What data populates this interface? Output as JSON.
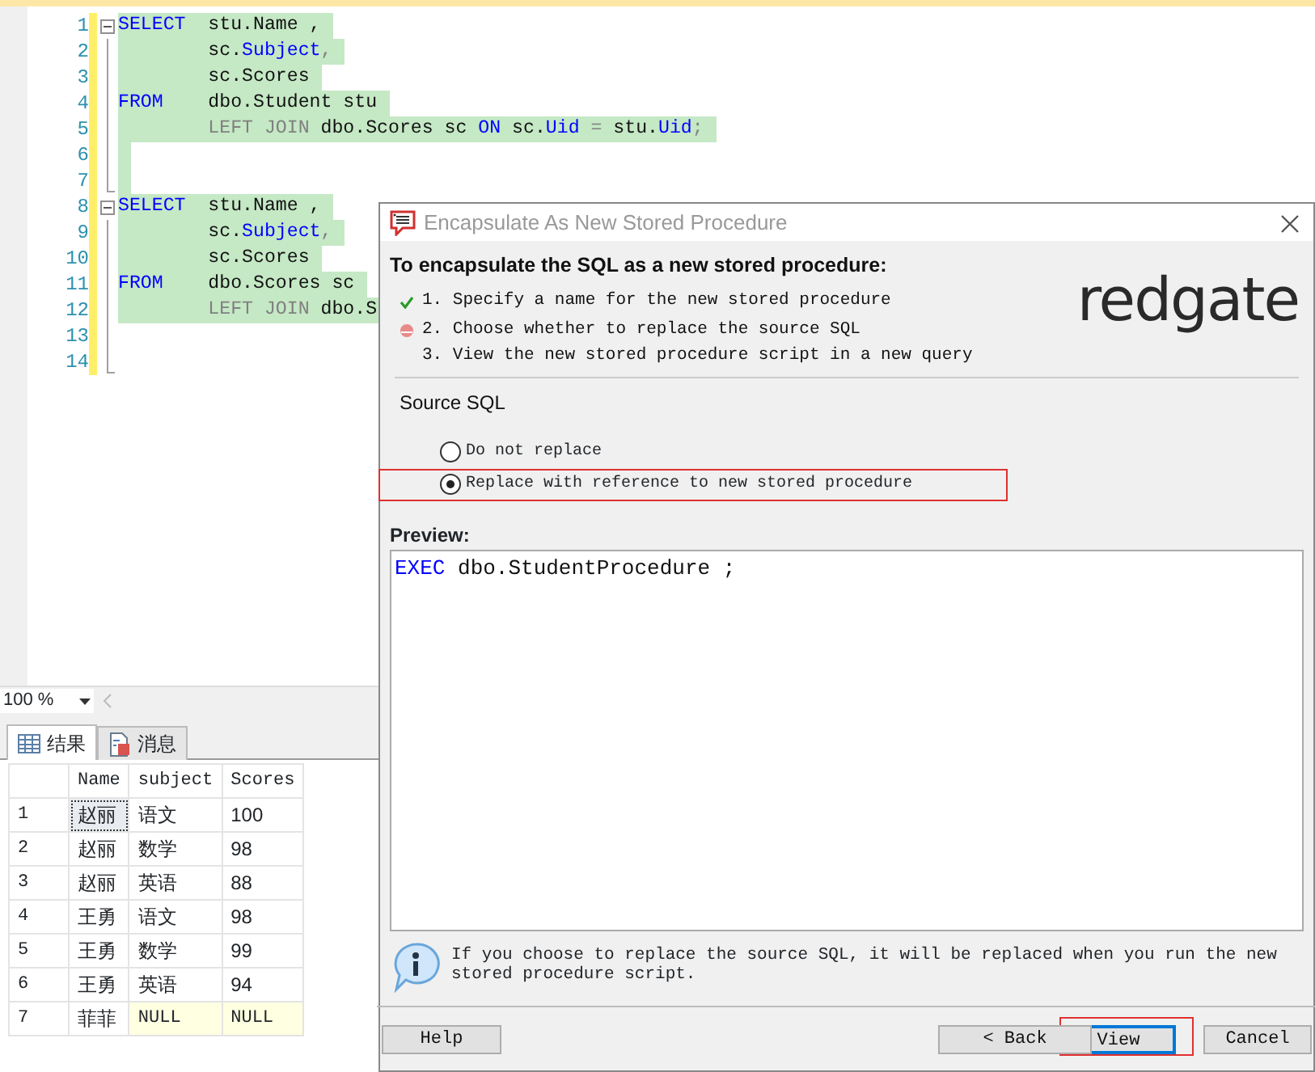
{
  "editor": {
    "lines": [
      {
        "number": "1",
        "changed": true,
        "collapsible": true,
        "highlighted": true,
        "tokens": [
          {
            "text": "SELECT",
            "kind": "keyword"
          },
          {
            "text": "  stu.Name ,",
            "kind": "plain"
          }
        ]
      },
      {
        "number": "2",
        "changed": true,
        "collapsible": false,
        "highlighted": true,
        "tokens": [
          {
            "text": "        sc.",
            "kind": "plain"
          },
          {
            "text": "Subject",
            "kind": "keyword"
          },
          {
            "text": ",",
            "kind": "operator"
          }
        ]
      },
      {
        "number": "3",
        "changed": true,
        "collapsible": false,
        "highlighted": true,
        "tokens": [
          {
            "text": "        sc.Scores",
            "kind": "plain"
          }
        ]
      },
      {
        "number": "4",
        "changed": true,
        "collapsible": false,
        "highlighted": true,
        "tokens": [
          {
            "text": "FROM",
            "kind": "keyword"
          },
          {
            "text": "    dbo.Student stu",
            "kind": "plain"
          }
        ]
      },
      {
        "number": "5",
        "changed": true,
        "collapsible": false,
        "highlighted": true,
        "tokens": [
          {
            "text": "        LEFT JOIN",
            "kind": "operator"
          },
          {
            "text": " dbo.Scores sc ",
            "kind": "plain"
          },
          {
            "text": "ON",
            "kind": "keyword"
          },
          {
            "text": " sc.",
            "kind": "plain"
          },
          {
            "text": "Uid",
            "kind": "keyword"
          },
          {
            "text": " = ",
            "kind": "operator"
          },
          {
            "text": "stu.",
            "kind": "plain"
          },
          {
            "text": "Uid",
            "kind": "keyword"
          },
          {
            "text": ";",
            "kind": "operator"
          }
        ]
      },
      {
        "number": "6",
        "changed": true,
        "collapsible": false,
        "highlighted": true
      },
      {
        "number": "7",
        "changed": true,
        "collapsible": false,
        "highlighted": true
      },
      {
        "number": "8",
        "changed": true,
        "collapsible": true,
        "highlighted": true,
        "tokens": [
          {
            "text": "SELECT",
            "kind": "keyword"
          },
          {
            "text": "  stu.Name ,",
            "kind": "plain"
          }
        ]
      },
      {
        "number": "9",
        "changed": true,
        "collapsible": false,
        "highlighted": true,
        "tokens": [
          {
            "text": "        sc.",
            "kind": "plain"
          },
          {
            "text": "Subject",
            "kind": "keyword"
          },
          {
            "text": ",",
            "kind": "operator"
          }
        ]
      },
      {
        "number": "10",
        "changed": true,
        "collapsible": false,
        "highlighted": true,
        "tokens": [
          {
            "text": "        sc.Scores",
            "kind": "plain"
          }
        ]
      },
      {
        "number": "11",
        "changed": true,
        "collapsible": false,
        "highlighted": true,
        "tokens": [
          {
            "text": "FROM",
            "kind": "keyword"
          },
          {
            "text": "    dbo.Scores sc",
            "kind": "plain"
          }
        ]
      },
      {
        "number": "12",
        "changed": true,
        "collapsible": false,
        "highlighted": true,
        "tokens": [
          {
            "text": "        LEFT JOIN",
            "kind": "operator"
          },
          {
            "text": " dbo.S",
            "kind": "plain"
          }
        ]
      },
      {
        "number": "13",
        "changed": true,
        "collapsible": false,
        "highlighted": false
      },
      {
        "number": "14",
        "changed": true,
        "collapsible": false,
        "highlighted": false
      }
    ]
  },
  "zoom": {
    "value": "100 %"
  },
  "result_tabs": [
    {
      "label": "结果",
      "selected": true
    },
    {
      "label": "消息",
      "selected": false
    }
  ],
  "results": {
    "columns": [
      "Name",
      "subject",
      "Scores"
    ],
    "rows": [
      {
        "number": "1",
        "cells": [
          {
            "text": "赵丽",
            "null": false,
            "focused": true
          },
          {
            "text": "语文",
            "null": false,
            "focused": false
          },
          {
            "text": "100",
            "null": false,
            "focused": false
          }
        ]
      },
      {
        "number": "2",
        "cells": [
          {
            "text": "赵丽",
            "null": false,
            "focused": false
          },
          {
            "text": "数学",
            "null": false,
            "focused": false
          },
          {
            "text": "98",
            "null": false,
            "focused": false
          }
        ]
      },
      {
        "number": "3",
        "cells": [
          {
            "text": "赵丽",
            "null": false,
            "focused": false
          },
          {
            "text": "英语",
            "null": false,
            "focused": false
          },
          {
            "text": "88",
            "null": false,
            "focused": false
          }
        ]
      },
      {
        "number": "4",
        "cells": [
          {
            "text": "王勇",
            "null": false,
            "focused": false
          },
          {
            "text": "语文",
            "null": false,
            "focused": false
          },
          {
            "text": "98",
            "null": false,
            "focused": false
          }
        ]
      },
      {
        "number": "5",
        "cells": [
          {
            "text": "王勇",
            "null": false,
            "focused": false
          },
          {
            "text": "数学",
            "null": false,
            "focused": false
          },
          {
            "text": "99",
            "null": false,
            "focused": false
          }
        ]
      },
      {
        "number": "6",
        "cells": [
          {
            "text": "王勇",
            "null": false,
            "focused": false
          },
          {
            "text": "英语",
            "null": false,
            "focused": false
          },
          {
            "text": "94",
            "null": false,
            "focused": false
          }
        ]
      },
      {
        "number": "7",
        "cells": [
          {
            "text": "菲菲",
            "null": false,
            "focused": false
          },
          {
            "text": "NULL",
            "null": true,
            "focused": false
          },
          {
            "text": "NULL",
            "null": true,
            "focused": false
          }
        ]
      }
    ]
  },
  "dialog": {
    "title": "Encapsulate As New Stored Procedure",
    "heading": "To encapsulate the SQL as a new stored procedure:",
    "logo": "redgate",
    "steps": [
      {
        "text": "1. Specify a name for the new stored procedure",
        "kind": "done"
      },
      {
        "text": "2. Choose whether to replace the source SQL",
        "kind": "current"
      },
      {
        "text": "3. View the new stored procedure script in a new query",
        "kind": "pending"
      }
    ],
    "section": "Source SQL",
    "options": [
      {
        "label": "Do not replace",
        "selected": false,
        "annotated": false
      },
      {
        "label": "Replace with reference to new stored procedure",
        "selected": true,
        "annotated": true
      }
    ],
    "preview_label": "Preview:",
    "preview": [
      {
        "text": "EXEC",
        "kind": "keyword"
      },
      {
        "text": " dbo.StudentProcedure ;",
        "kind": "plain"
      }
    ],
    "info": "If you choose to replace the source SQL, it will be replaced when you run the new stored procedure script.",
    "buttons": [
      {
        "label": "Help",
        "default": false,
        "annotated": false
      },
      {
        "label": "< Back",
        "default": false,
        "annotated": false
      },
      {
        "label": "View",
        "default": true,
        "annotated": true
      },
      {
        "label": "Cancel",
        "default": false,
        "annotated": false
      }
    ]
  }
}
